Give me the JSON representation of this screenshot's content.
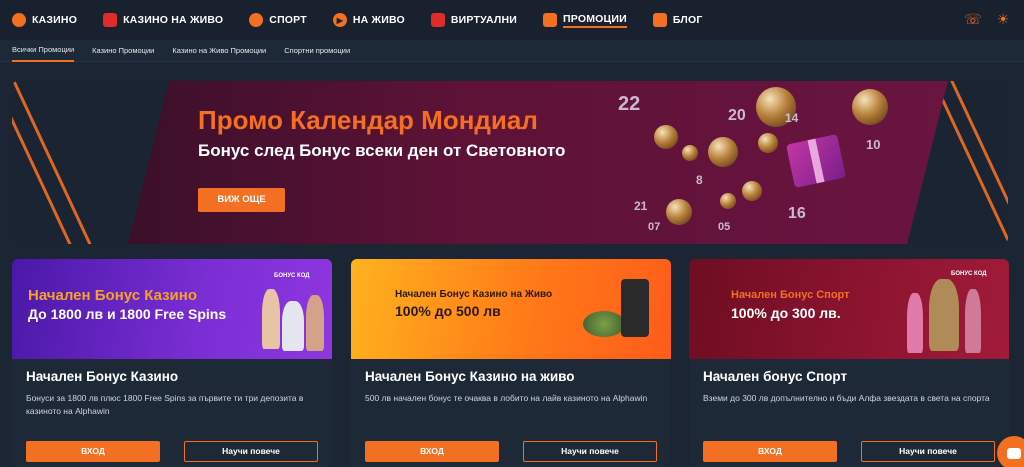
{
  "nav": {
    "items": [
      {
        "label": "КАЗИНО",
        "icon": "casino-chip-icon"
      },
      {
        "label": "КАЗИНО НА ЖИВО",
        "icon": "live-icon"
      },
      {
        "label": "СПОРТ",
        "icon": "ball-icon"
      },
      {
        "label": "НА ЖИВО",
        "icon": "play-icon"
      },
      {
        "label": "ВИРТУАЛНИ",
        "icon": "virtual-icon"
      },
      {
        "label": "ПРОМОЦИИ",
        "icon": "gift-icon"
      },
      {
        "label": "БЛОГ",
        "icon": "blog-icon"
      }
    ],
    "active": "ПРОМОЦИИ",
    "right_icons": [
      "support-chat-icon",
      "theme-sun-icon"
    ]
  },
  "subnav": {
    "items": [
      "Всички Промоции",
      "Казино Промоции",
      "Казино на Живо Промоции",
      "Спортни промоции"
    ],
    "active": "Всички Промоции"
  },
  "hero": {
    "title": "Промо Календар Мондиал",
    "subtitle": "Бонус след Бонус всеки ден от Световното",
    "button": "ВИЖ ОЩЕ",
    "numbers": [
      "22",
      "20",
      "14",
      "10",
      "8",
      "21",
      "16",
      "07",
      "05"
    ]
  },
  "cards": [
    {
      "banner_line1": "Начален Бонус Казино",
      "banner_line2": "До 1800 лв и 1800 Free Spins",
      "banner_badge": "БОНУС КОД",
      "title": "Начален Бонус Казино",
      "description": "Бонуси за 1800 лв плюс 1800 Free Spins за първите ти три депозита в казиното на Alphawin",
      "enter": "ВХОД",
      "more": "Научи повече"
    },
    {
      "banner_line1": "Начален Бонус Казино на Живо",
      "banner_line2": "100% до 500 лв",
      "title": "Начален Бонус Казино на живо",
      "description": "500 лв начален бонус те очаква в лобито на лайв казиното на Alphawin",
      "enter": "ВХОД",
      "more": "Научи повече"
    },
    {
      "banner_line1": "Начален Бонус Спорт",
      "banner_line2": "100% до 300 лв.",
      "banner_badge": "БОНУС КОД",
      "title": "Начален бонус Спорт",
      "description": "Вземи до 300 лв допълнително и бъди Алфа звездата в света на спорта",
      "enter": "ВХОД",
      "more": "Научи повече"
    }
  ],
  "colors": {
    "accent": "#f36f21",
    "background": "#1b2533",
    "card": "#1e2937"
  }
}
